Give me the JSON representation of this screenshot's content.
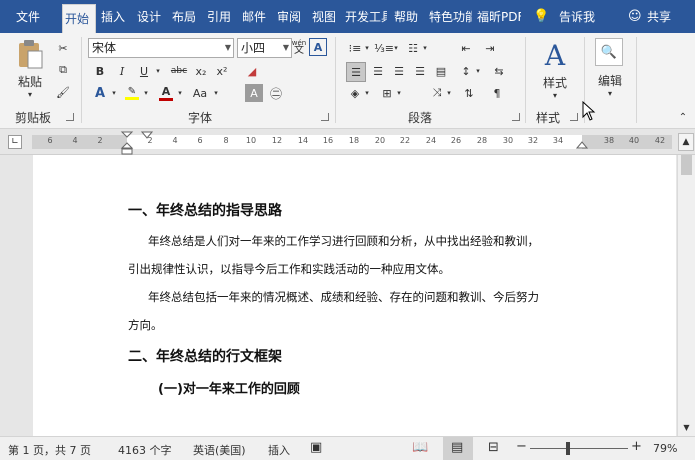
{
  "tabs": [
    {
      "label": "文件",
      "active": false
    },
    {
      "label": "开始",
      "active": true
    },
    {
      "label": "插入",
      "active": false
    },
    {
      "label": "设计",
      "active": false
    },
    {
      "label": "布局",
      "active": false
    },
    {
      "label": "引用",
      "active": false
    },
    {
      "label": "邮件",
      "active": false
    },
    {
      "label": "审阅",
      "active": false
    },
    {
      "label": "视图",
      "active": false
    },
    {
      "label": "开发工具",
      "active": false
    },
    {
      "label": "帮助",
      "active": false
    },
    {
      "label": "特色功能",
      "active": false
    },
    {
      "label": "福昕PDF",
      "active": false
    }
  ],
  "tell_me": "告诉我",
  "share": "共享",
  "clipboard": {
    "paste": "粘贴",
    "label": "剪贴板"
  },
  "font": {
    "name": "宋体",
    "size": "小四",
    "label": "字体",
    "wen": "wén",
    "aa_label": "Aa"
  },
  "paragraph": {
    "label": "段落"
  },
  "styles": {
    "button": "样式",
    "label": "样式"
  },
  "editing": {
    "button": "编辑"
  },
  "ruler": {
    "ticks": [
      "6",
      "4",
      "2",
      "2",
      "4",
      "6",
      "8",
      "10",
      "12",
      "14",
      "16",
      "18",
      "20",
      "22",
      "24",
      "26",
      "28",
      "30",
      "32",
      "34",
      "38",
      "40",
      "42"
    ]
  },
  "document": {
    "heading1": "一、年终总结的指导思路",
    "p1_line1": "年终总结是人们对一年来的工作学习进行回顾和分析，从中找出经验和教训，",
    "p1_line2": "引出规律性认识，以指导今后工作和实践活动的一种应用文体。",
    "p2_line1": "年终总结包括一年来的情况概述、成绩和经验、存在的问题和教训、今后努力",
    "p2_line2": "方向。",
    "heading2": "二、年终总结的行文框架",
    "subheading": "(一)对一年来工作的回顾"
  },
  "status": {
    "page": "第 1 页，共 7 页",
    "words": "4163 个字",
    "language": "英语(美国)",
    "mode": "插入",
    "zoom": "79%"
  },
  "colors": {
    "brand": "#2b579a",
    "highlight": "#ffff00",
    "font_color": "#c00000"
  }
}
